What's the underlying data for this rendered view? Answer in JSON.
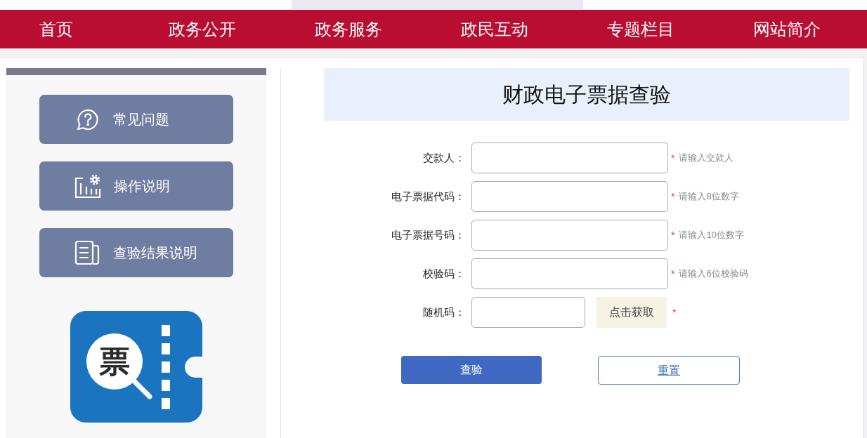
{
  "nav": {
    "items": [
      {
        "label": "首页"
      },
      {
        "label": "政务公开"
      },
      {
        "label": "政务服务"
      },
      {
        "label": "政民互动"
      },
      {
        "label": "专题栏目"
      },
      {
        "label": "网站简介"
      }
    ]
  },
  "sidebar": {
    "buttons": [
      {
        "label": "常见问题"
      },
      {
        "label": "操作说明"
      },
      {
        "label": "查验结果说明"
      }
    ],
    "logo": {
      "text": "票"
    }
  },
  "page_title": "财政电子票据查验",
  "form": {
    "fields": [
      {
        "kind": "text",
        "label": "交款人：",
        "required_mark": "*",
        "hint": "请输入交款人"
      },
      {
        "kind": "text",
        "label": "电子票据代码：",
        "required_mark": "*",
        "hint": "请输入8位数字"
      },
      {
        "kind": "text",
        "label": "电子票据号码：",
        "required_mark": "*",
        "hint": "请输入10位数字"
      },
      {
        "kind": "text",
        "label": "校验码：",
        "required_mark": "*",
        "hint": "请输入6位校验码"
      },
      {
        "kind": "captcha",
        "label": "随机码：",
        "captcha_text": "点击获取",
        "required_mark": "*"
      }
    ],
    "buttons": [
      {
        "kind": "primary",
        "label": "查验"
      },
      {
        "kind": "secondary",
        "label": "重置"
      }
    ]
  }
}
